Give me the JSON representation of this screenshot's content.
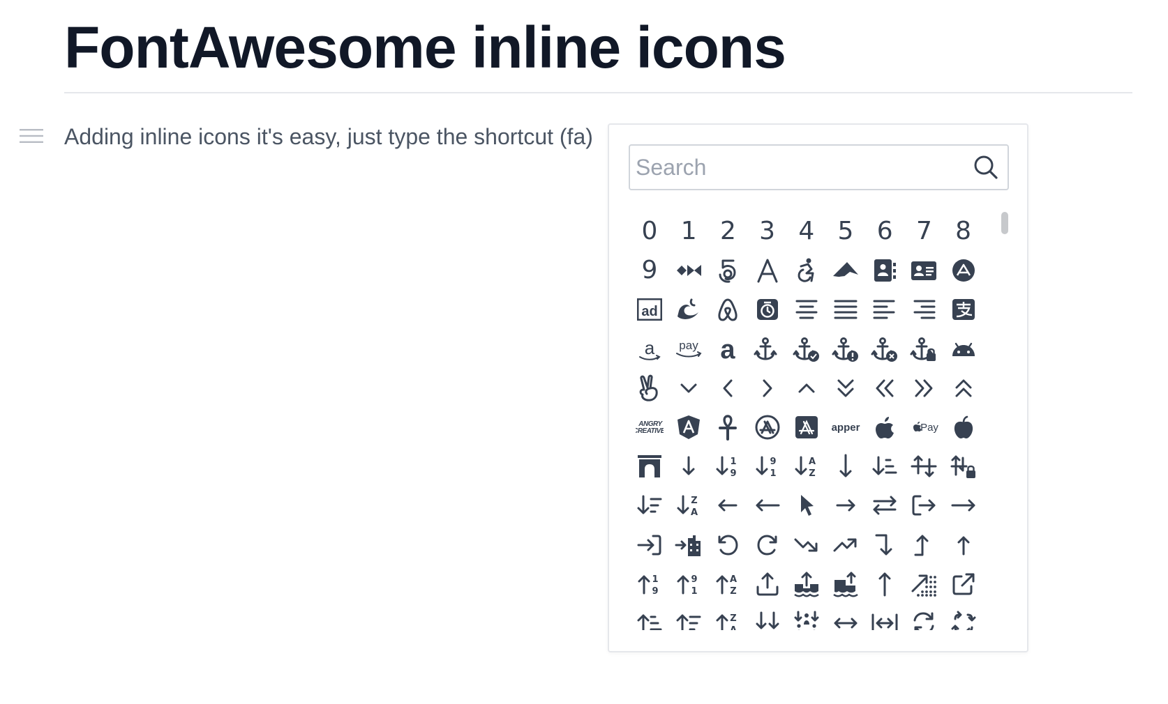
{
  "page": {
    "title": "FontAwesome inline icons",
    "paragraph": "Adding inline icons it's easy, just type the shortcut (fa)"
  },
  "colors": {
    "title": "#111827",
    "text": "#4b5563",
    "icon": "#374151",
    "border": "#e5e7eb",
    "placeholder": "#9ca3af"
  },
  "picker": {
    "search_placeholder": "Search",
    "search_value": "",
    "icons": [
      {
        "name": "digit-0",
        "label": "0"
      },
      {
        "name": "digit-1",
        "label": "1"
      },
      {
        "name": "digit-2",
        "label": "2"
      },
      {
        "name": "digit-3",
        "label": "3"
      },
      {
        "name": "digit-4",
        "label": "4"
      },
      {
        "name": "digit-5",
        "label": "5"
      },
      {
        "name": "digit-6",
        "label": "6"
      },
      {
        "name": "digit-7",
        "label": "7"
      },
      {
        "name": "digit-8",
        "label": "8"
      },
      {
        "name": "digit-9",
        "label": "9"
      },
      {
        "name": "42-group-icon"
      },
      {
        "name": "500px-icon"
      },
      {
        "name": "letter-a-icon"
      },
      {
        "name": "accessible-icon"
      },
      {
        "name": "accusoft-icon"
      },
      {
        "name": "address-book-icon"
      },
      {
        "name": "address-card-icon"
      },
      {
        "name": "adn-icon"
      },
      {
        "name": "ad-icon",
        "label": "ad"
      },
      {
        "name": "adversal-icon"
      },
      {
        "name": "airbnb-icon"
      },
      {
        "name": "alarm-clock-icon"
      },
      {
        "name": "align-center-icon"
      },
      {
        "name": "align-justify-icon"
      },
      {
        "name": "align-left-icon"
      },
      {
        "name": "align-right-icon"
      },
      {
        "name": "alipay-icon"
      },
      {
        "name": "amazon-icon",
        "label": "a"
      },
      {
        "name": "amazon-pay-icon",
        "label": "pay"
      },
      {
        "name": "amilia-icon",
        "label": "a"
      },
      {
        "name": "anchor-icon"
      },
      {
        "name": "anchor-circle-check-icon"
      },
      {
        "name": "anchor-circle-exclamation-icon"
      },
      {
        "name": "anchor-circle-xmark-icon"
      },
      {
        "name": "anchor-lock-icon"
      },
      {
        "name": "android-icon"
      },
      {
        "name": "angellist-icon"
      },
      {
        "name": "angle-down-icon"
      },
      {
        "name": "angle-left-icon"
      },
      {
        "name": "angle-right-icon"
      },
      {
        "name": "angle-up-icon"
      },
      {
        "name": "angles-down-icon"
      },
      {
        "name": "angles-left-icon"
      },
      {
        "name": "angles-right-icon"
      },
      {
        "name": "angles-up-icon"
      },
      {
        "name": "angry-creative-icon",
        "label": "ANGRY CREATIVE"
      },
      {
        "name": "angular-icon"
      },
      {
        "name": "ankh-icon"
      },
      {
        "name": "app-store-icon"
      },
      {
        "name": "app-store-ios-icon"
      },
      {
        "name": "apper-icon",
        "label": "apper"
      },
      {
        "name": "apple-icon"
      },
      {
        "name": "apple-pay-icon",
        "label": "Pay"
      },
      {
        "name": "apple-whole-icon"
      },
      {
        "name": "archway-icon"
      },
      {
        "name": "arrow-down-icon"
      },
      {
        "name": "arrow-down-1-9-icon"
      },
      {
        "name": "arrow-down-9-1-icon"
      },
      {
        "name": "arrow-down-a-z-icon"
      },
      {
        "name": "arrow-down-long-icon"
      },
      {
        "name": "arrow-down-short-wide-icon"
      },
      {
        "name": "arrow-down-up-across-line-icon"
      },
      {
        "name": "arrow-down-up-lock-icon"
      },
      {
        "name": "arrow-down-wide-short-icon"
      },
      {
        "name": "arrow-down-z-a-icon"
      },
      {
        "name": "arrow-left-icon"
      },
      {
        "name": "arrow-left-long-icon"
      },
      {
        "name": "arrow-pointer-icon"
      },
      {
        "name": "arrow-right-icon"
      },
      {
        "name": "arrow-right-arrow-left-icon"
      },
      {
        "name": "arrow-right-from-bracket-icon"
      },
      {
        "name": "arrow-right-long-icon"
      },
      {
        "name": "arrow-right-to-bracket-icon"
      },
      {
        "name": "arrow-right-to-city-icon"
      },
      {
        "name": "arrow-rotate-left-icon"
      },
      {
        "name": "arrow-rotate-right-icon"
      },
      {
        "name": "arrow-trend-down-icon"
      },
      {
        "name": "arrow-trend-up-icon"
      },
      {
        "name": "arrow-turn-down-icon"
      },
      {
        "name": "arrow-turn-up-icon"
      },
      {
        "name": "arrow-up-icon"
      },
      {
        "name": "arrow-up-1-9-icon"
      },
      {
        "name": "arrow-up-9-1-icon"
      },
      {
        "name": "arrow-up-a-z-icon"
      },
      {
        "name": "arrow-up-from-bracket-icon"
      },
      {
        "name": "arrow-up-from-ground-water-icon"
      },
      {
        "name": "arrow-up-from-water-pump-icon"
      },
      {
        "name": "arrow-up-long-icon"
      },
      {
        "name": "arrow-up-right-dots-icon"
      },
      {
        "name": "arrow-up-right-from-square-icon"
      },
      {
        "name": "arrow-up-short-wide-icon"
      },
      {
        "name": "arrow-up-wide-short-icon"
      },
      {
        "name": "arrow-up-z-a-icon"
      },
      {
        "name": "arrows-down-to-line-icon"
      },
      {
        "name": "arrows-down-to-people-icon"
      },
      {
        "name": "arrows-left-right-icon"
      },
      {
        "name": "arrows-left-right-to-line-icon"
      },
      {
        "name": "arrows-rotate-icon"
      },
      {
        "name": "arrows-spin-icon"
      }
    ]
  }
}
